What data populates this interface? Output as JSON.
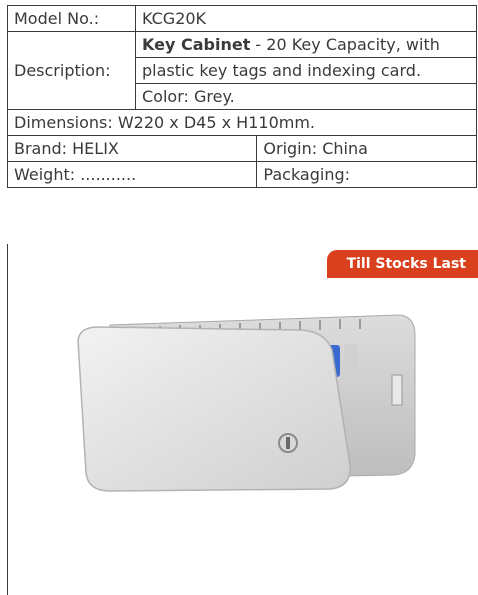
{
  "rows": {
    "model_label": "Model No.:",
    "model_value": "KCG20K",
    "description_label": "Description:",
    "desc_title": "Key Cabinet",
    "desc_line1_rest": " - 20 Key Capacity, with",
    "desc_line2": "plastic key tags and indexing card.",
    "desc_line3": "Color: Grey.",
    "dimensions": "Dimensions: W220 x D45 x H110mm.",
    "brand": "Brand: HELIX",
    "origin": "Origin: China",
    "weight": "Weight: ...........",
    "packaging": "Packaging:"
  },
  "badge": "Till Stocks Last",
  "colors": {
    "badge": "#d9411e",
    "cabinet": "#e6e6e6",
    "text": "#3a3a3a"
  },
  "image": {
    "subject": "grey key cabinet with colored key tags"
  }
}
